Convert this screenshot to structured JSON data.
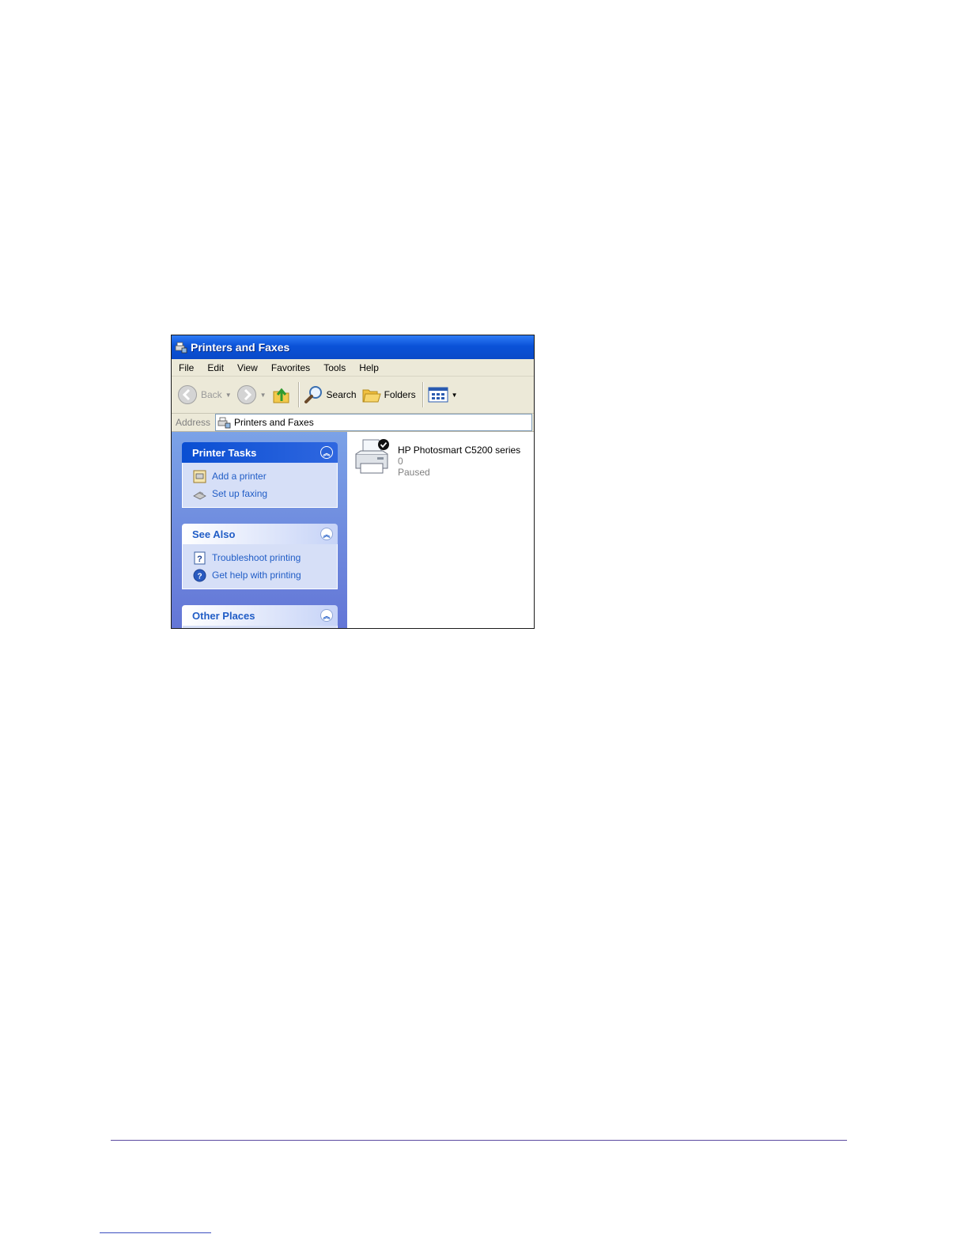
{
  "window": {
    "title": "Printers and Faxes"
  },
  "menubar": {
    "items": [
      "File",
      "Edit",
      "View",
      "Favorites",
      "Tools",
      "Help"
    ]
  },
  "toolbar": {
    "back_label": "Back",
    "search_label": "Search",
    "folders_label": "Folders",
    "icons": [
      "back-arrow-icon",
      "forward-arrow-icon",
      "up-folder-icon",
      "search-icon",
      "folders-icon",
      "views-icon"
    ]
  },
  "address": {
    "label": "Address",
    "value": "Printers and Faxes"
  },
  "taskpane": {
    "printer_tasks": {
      "title": "Printer Tasks",
      "items": [
        "Add a printer",
        "Set up faxing"
      ]
    },
    "see_also": {
      "title": "See Also",
      "items": [
        "Troubleshoot printing",
        "Get help with printing"
      ]
    },
    "other_places": {
      "title": "Other Places"
    }
  },
  "printer": {
    "name": "HP Photosmart C5200 series",
    "documents": "0",
    "status": "Paused",
    "default": true
  },
  "colors": {
    "title_bar": "#0a52d8",
    "task_link": "#215dc6",
    "taskpane_bg": "#7ba2e7"
  }
}
